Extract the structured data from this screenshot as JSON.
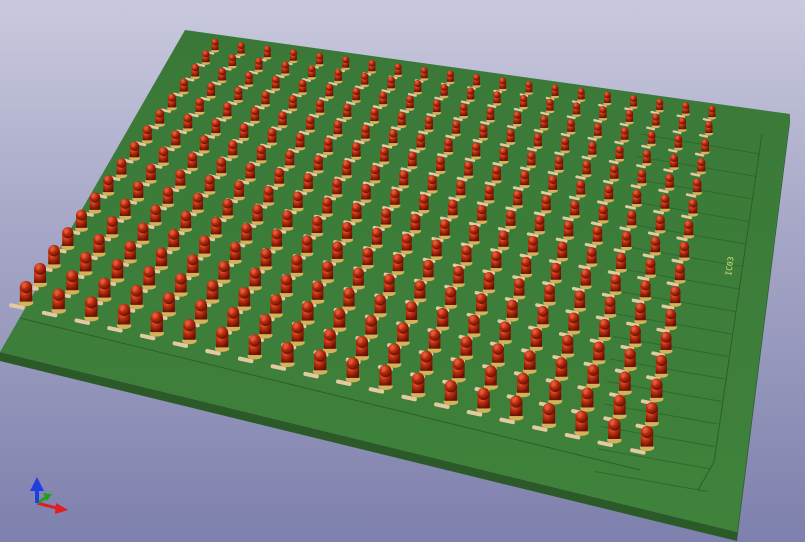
{
  "viewer": {
    "background_top": "#c9c9de",
    "background_bottom": "#7e80ad"
  },
  "board": {
    "color": "#3f7f3a",
    "edge_color": "#2c5e2a",
    "silkscreen_label": "IC03",
    "silkscreen_color": "#d8e27a"
  },
  "led_matrix": {
    "rows": 16,
    "columns": 20,
    "led_color": "#b8270d",
    "led_highlight": "#e6543a",
    "resistor_color": "#e4c9a2"
  },
  "axis_gizmo": {
    "x_axis_color": "#e11d1d",
    "y_axis_color": "#1ea21e",
    "z_axis_color": "#1f3fe0"
  }
}
